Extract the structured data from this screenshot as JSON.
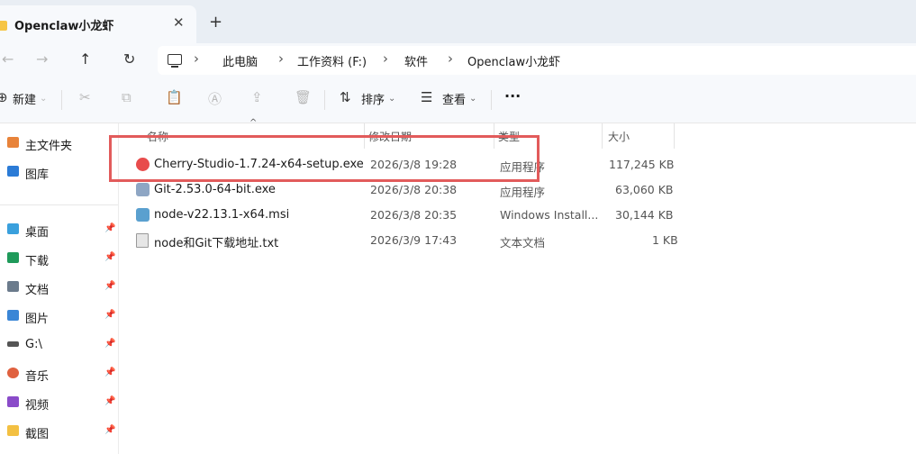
{
  "tab": {
    "title": "Openclaw小龙虾",
    "close": "✕",
    "new_tab": "+"
  },
  "nav": {
    "back": "←",
    "forward": "→",
    "up": "↑",
    "refresh": "↻"
  },
  "breadcrumbs": [
    "此电脑",
    "工作资料 (F:)",
    "软件",
    "Openclaw小龙虾"
  ],
  "toolbar": {
    "new_label": "新建",
    "sort_label": "排序",
    "view_label": "查看",
    "more": "···"
  },
  "sidebar": {
    "items": [
      {
        "label": "主文件夹",
        "icon": "home-icon",
        "color": "#e8833a"
      },
      {
        "label": "图库",
        "icon": "gallery-icon",
        "color": "#2b7bd6"
      },
      {
        "label": "桌面",
        "icon": "desktop-icon",
        "color": "#3aa0dd"
      },
      {
        "label": "下载",
        "icon": "download-icon",
        "color": "#1f9a5a"
      },
      {
        "label": "文档",
        "icon": "document-icon",
        "color": "#6b7b8c"
      },
      {
        "label": "图片",
        "icon": "pictures-icon",
        "color": "#3a86d6"
      },
      {
        "label": "G:\\",
        "icon": "drive-icon",
        "color": "#555555"
      },
      {
        "label": "音乐",
        "icon": "music-icon",
        "color": "#e0613f"
      },
      {
        "label": "视频",
        "icon": "video-icon",
        "color": "#8a4bc9"
      },
      {
        "label": "截图",
        "icon": "screenshot-folder-icon",
        "color": "#f3c042"
      }
    ]
  },
  "columns": [
    "名称",
    "修改日期",
    "类型",
    "大小"
  ],
  "files": [
    {
      "name": "Cherry-Studio-1.7.24-x64-setup.exe",
      "date": "2026/3/8 19:28",
      "type": "应用程序",
      "size": "117,245 KB",
      "icon": "cherry-studio-icon",
      "color": "#e84c4c"
    },
    {
      "name": "Git-2.53.0-64-bit.exe",
      "date": "2026/3/8 20:38",
      "type": "应用程序",
      "size": "63,060 KB",
      "icon": "git-installer-icon",
      "color": "#8ea6c4"
    },
    {
      "name": "node-v22.13.1-x64.msi",
      "date": "2026/3/8 20:35",
      "type": "Windows Install...",
      "size": "30,144 KB",
      "icon": "msi-installer-icon",
      "color": "#5aa0cf"
    },
    {
      "name": "node和Git下载地址.txt",
      "date": "2026/3/9 17:43",
      "type": "文本文档",
      "size": "1 KB",
      "icon": "text-file-icon",
      "color": "#e6e6e6"
    }
  ],
  "colors": {
    "highlight": "#e25b5b",
    "folder": "#f6c545"
  }
}
